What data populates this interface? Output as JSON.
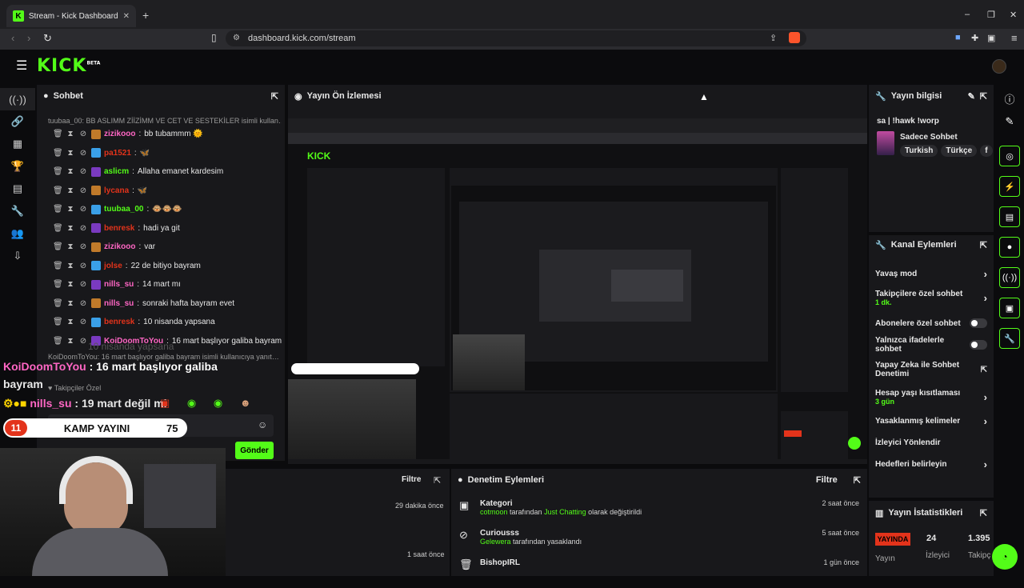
{
  "browser": {
    "tab_title": "Stream - Kick Dashboard",
    "url": "dashboard.kick.com/stream",
    "new_tab": "+",
    "close": "✕",
    "minimize": "–",
    "maximize": "❐",
    "win_close": "✕"
  },
  "header": {
    "logo": "KICK",
    "logo_sup": "BETA"
  },
  "chat": {
    "title": "Sohbet",
    "top_message": "tuubaa_00: BB ASLIMM ZİİZİMM VE CET VE SESTEKİLER isimli kullan…",
    "rows": [
      {
        "user": "zizikooo",
        "color": "#ff66c4",
        "text": "bb tubammm 🌞"
      },
      {
        "user": "pa1521",
        "color": "#e3331b",
        "text": "🦋"
      },
      {
        "user": "aslicm",
        "color": "#53fc18",
        "text": "Allaha emanet kardesim"
      },
      {
        "user": "lycana",
        "color": "#e3331b",
        "text": "🦋"
      },
      {
        "user": "tuubaa_00",
        "color": "#53fc18",
        "text": "🐵🐵🐵"
      },
      {
        "user": "benresk",
        "color": "#e3331b",
        "text": "hadi ya git"
      },
      {
        "user": "zizikooo",
        "color": "#ff66c4",
        "text": "var"
      },
      {
        "user": "jolse",
        "color": "#e3331b",
        "text": "22 de bitiyo bayram"
      },
      {
        "user": "nills_su",
        "color": "#ff66c4",
        "text": "14 mart mı"
      },
      {
        "user": "nills_su",
        "color": "#ff66c4",
        "text": "sonraki hafta bayram evet"
      },
      {
        "user": "benresk",
        "color": "#e3331b",
        "text": "10 nisanda yapsana"
      },
      {
        "user": "KoiDoomToYou",
        "color": "#ff66c4",
        "text": "16 mart başlıyor galiba bayram"
      }
    ],
    "reply_preview": "KoiDoomToYou: 16 mart başlıyor galiba bayram isimli kullanıcıya yanıt…",
    "ghost_line": "10 nisanda yapsana",
    "big_user": "KoiDoomToYou",
    "big_text": "16 mart başlıyor galiba",
    "big_text_2": "bayram",
    "followers_label": "Takipçiler Özel",
    "big2_user": "nills_su",
    "big2_text": "19 mart değil mi",
    "send_label": "Gönder"
  },
  "kamp": {
    "badge": "11",
    "label": "KAMP YAYINI",
    "value": "75"
  },
  "preview": {
    "title": "Yayın Ön İzlemesi"
  },
  "stream_info": {
    "title": "Yayın bilgisi",
    "stream_title": "sa | !hawk !worp",
    "chat_mode": "Sadece Sohbet",
    "tags": [
      "Turkish",
      "Türkçe",
      "f"
    ]
  },
  "channel_actions": {
    "title": "Kanal Eylemleri",
    "items": [
      {
        "label": "Yavaş mod",
        "sub": "",
        "control": "chevron"
      },
      {
        "label": "Takipçilere özel sohbet",
        "sub": "1 dk.",
        "control": "chevron"
      },
      {
        "label": "Abonelere özel sohbet",
        "sub": "",
        "control": "toggle"
      },
      {
        "label": "Yalnızca ifadelerle sohbet",
        "sub": "",
        "control": "toggle"
      },
      {
        "label": "Yapay Zeka ile Sohbet Denetimi",
        "sub": "",
        "control": "external"
      },
      {
        "label": "Hesap yaşı kısıtlaması",
        "sub": "3 gün",
        "control": "chevron"
      },
      {
        "label": "Yasaklanmış kelimeler",
        "sub": "",
        "control": "chevron"
      },
      {
        "label": "İzleyici Yönlendir",
        "sub": "",
        "control": "none"
      },
      {
        "label": "Hedefleri belirleyin",
        "sub": "",
        "control": "chevron"
      }
    ]
  },
  "stats": {
    "title": "Yayın İstatistikleri",
    "live": "YAYINDA",
    "viewers": "24",
    "followers": "1.395",
    "label_stream": "Yayın",
    "label_viewers": "İzleyici",
    "label_followers": "Takipç"
  },
  "bottom_left": {
    "filter": "Filtre",
    "times": [
      "29 dakika önce",
      "1 saat önce"
    ]
  },
  "moderation": {
    "title": "Denetim Eylemleri",
    "filter": "Filtre",
    "rows": [
      {
        "icon": "category-icon",
        "title": "Kategori",
        "pre": "cotmoon",
        "mid": " tarafından ",
        "hl": "Just Chatting",
        "post": " olarak değiştirildi",
        "time": "2 saat önce"
      },
      {
        "icon": "ban-icon",
        "title": "Curiousss",
        "pre": "Gelewera",
        "mid": " tarafından yasaklandı",
        "hl": "",
        "post": "",
        "time": "5 saat önce"
      },
      {
        "icon": "trash-icon",
        "title": "BishopIRL",
        "pre": "",
        "mid": "",
        "hl": "",
        "post": "",
        "time": "1 gün önce"
      }
    ]
  }
}
